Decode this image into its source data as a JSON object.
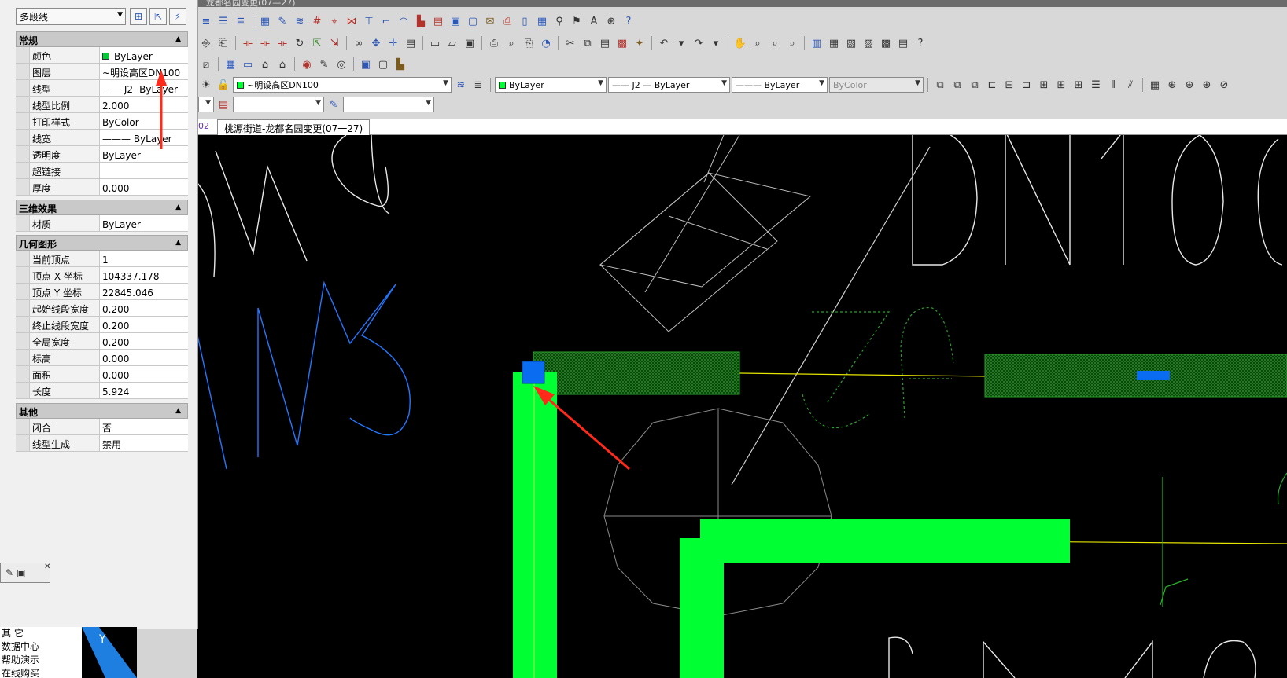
{
  "window": {
    "title_fragment": "龙都名园变更(07—27)"
  },
  "properties_panel": {
    "object_type": "多段线",
    "sections": [
      {
        "title": "常规",
        "rows": [
          {
            "name": "颜色",
            "value": "ByLayer"
          },
          {
            "name": "图层",
            "value": "~明设高区DN100"
          },
          {
            "name": "线型",
            "value": "—— J2- ByLayer"
          },
          {
            "name": "线型比例",
            "value": "2.000"
          },
          {
            "name": "打印样式",
            "value": "ByColor"
          },
          {
            "name": "线宽",
            "value": "——— ByLayer"
          },
          {
            "name": "透明度",
            "value": "ByLayer"
          },
          {
            "name": "超链接",
            "value": ""
          },
          {
            "name": "厚度",
            "value": "0.000"
          }
        ]
      },
      {
        "title": "三维效果",
        "rows": [
          {
            "name": "材质",
            "value": "ByLayer"
          }
        ]
      },
      {
        "title": "几何图形",
        "rows": [
          {
            "name": "当前顶点",
            "value": "1"
          },
          {
            "name": "顶点 X 坐标",
            "value": "104337.178"
          },
          {
            "name": "顶点 Y 坐标",
            "value": "22845.046"
          },
          {
            "name": "起始线段宽度",
            "value": "0.200"
          },
          {
            "name": "终止线段宽度",
            "value": "0.200"
          },
          {
            "name": "全局宽度",
            "value": "0.200"
          },
          {
            "name": "标高",
            "value": "0.000"
          },
          {
            "name": "面积",
            "value": "0.000"
          },
          {
            "name": "长度",
            "value": "5.924"
          }
        ]
      },
      {
        "title": "其他",
        "rows": [
          {
            "name": "闭合",
            "value": "否"
          },
          {
            "name": "线型生成",
            "value": "禁用"
          }
        ]
      }
    ]
  },
  "layer_bar": {
    "layer": "~明设高区DN100",
    "color": "ByLayer",
    "linetype": "—— J2 —  ByLayer",
    "lineweight": "———  ByLayer",
    "plotstyle": "ByColor"
  },
  "tabs": {
    "prev": "02",
    "active": "桃源街道-龙都名园变更(07一27)"
  },
  "left_menu": [
    "其    它",
    "数据中心",
    "帮助演示",
    "在线购买"
  ],
  "canvas_texts": {
    "ucs": "Y"
  },
  "colors": {
    "polyline": "#00ff33",
    "hatch": "#1a6b1a",
    "selection": "#0a6cf0",
    "arrow": "#ff2a1a",
    "pipe": "#ffff00"
  }
}
